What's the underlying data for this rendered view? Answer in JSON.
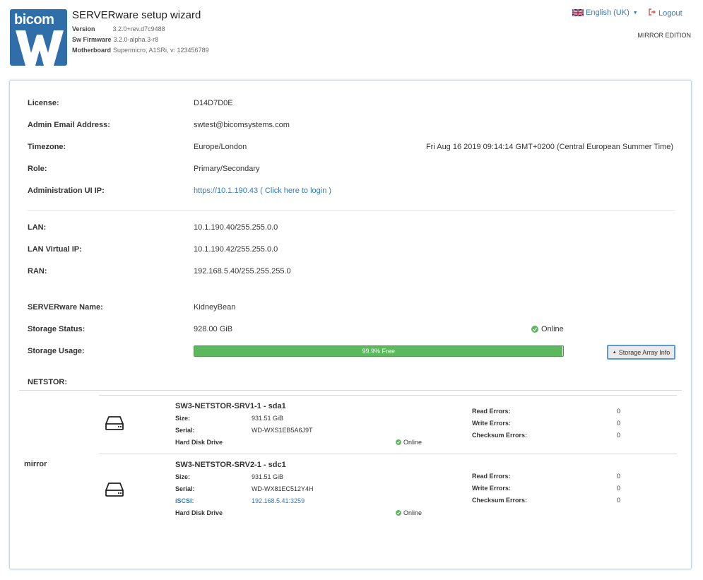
{
  "header": {
    "brand": "bicom",
    "title": "SERVERware setup wizard",
    "version_label": "Version",
    "version_value": "3.2.0+rev.d7c9488",
    "firmware_label": "Sw Firmware",
    "firmware_value": "3.2.0-alpha.3-r8",
    "motherboard_label": "Motherboard",
    "motherboard_value": "Supermicro, A1SRi, v: 123456789",
    "language": "English (UK)",
    "logout": "Logout",
    "edition": "MIRROR EDITION"
  },
  "info": {
    "license_label": "License:",
    "license_value": "D14D7D0E",
    "email_label": "Admin Email Address:",
    "email_value": "swtest@bicomsystems.com",
    "timezone_label": "Timezone:",
    "timezone_value": "Europe/London",
    "datetime": "Fri Aug 16 2019 09:14:14 GMT+0200 (Central European Summer Time)",
    "role_label": "Role:",
    "role_value": "Primary/Secondary",
    "admin_ip_label": "Administration UI IP:",
    "admin_ip_value": "https://10.1.190.43 ( Click here to login )"
  },
  "network": {
    "lan_label": "LAN:",
    "lan_value": "10.1.190.40/255.255.0.0",
    "lan_vip_label": "LAN Virtual IP:",
    "lan_vip_value": "10.1.190.42/255.255.0.0",
    "ran_label": "RAN:",
    "ran_value": "192.168.5.40/255.255.255.0"
  },
  "storage": {
    "name_label": "SERVERware Name:",
    "name_value": "KidneyBean",
    "status_label": "Storage Status:",
    "status_value": "928.00 GiB",
    "status_state": "Online",
    "usage_label": "Storage Usage:",
    "usage_text": "99.9% Free",
    "usage_free_percent": 99.9,
    "array_button": "Storage Array Info"
  },
  "netstor": {
    "label": "NETSTOR:",
    "group_label": "mirror",
    "disks": [
      {
        "title": "SW3-NETSTOR-SRV1-1 - sda1",
        "size_label": "Size:",
        "size_value": "931.51 GiB",
        "serial_label": "Serial:",
        "serial_value": "WD-WXS1EB5A6J9T",
        "type": "Hard Disk Drive",
        "state": "Online",
        "read_errors_label": "Read Errors:",
        "read_errors": "0",
        "write_errors_label": "Write Errors:",
        "write_errors": "0",
        "checksum_errors_label": "Checksum Errors:",
        "checksum_errors": "0"
      },
      {
        "title": "SW3-NETSTOR-SRV2-1 - sdc1",
        "size_label": "Size:",
        "size_value": "931.51 GiB",
        "serial_label": "Serial:",
        "serial_value": "WD-WX81EC512Y4H",
        "iscsi_label": "iSCSI:",
        "iscsi_value": "192.168.5.41:3259",
        "type": "Hard Disk Drive",
        "state": "Online",
        "read_errors_label": "Read Errors:",
        "read_errors": "0",
        "write_errors_label": "Write Errors:",
        "write_errors": "0",
        "checksum_errors_label": "Checksum Errors:",
        "checksum_errors": "0"
      }
    ]
  },
  "colors": {
    "accent": "#337ab7",
    "success": "#5cb85c",
    "logo_bg": "#2f6ea8",
    "logout_icon": "#d9534f"
  },
  "icons": [
    "uk-flag-icon",
    "logout-icon",
    "check-circle-icon",
    "hard-disk-icon",
    "caret-up-icon"
  ]
}
